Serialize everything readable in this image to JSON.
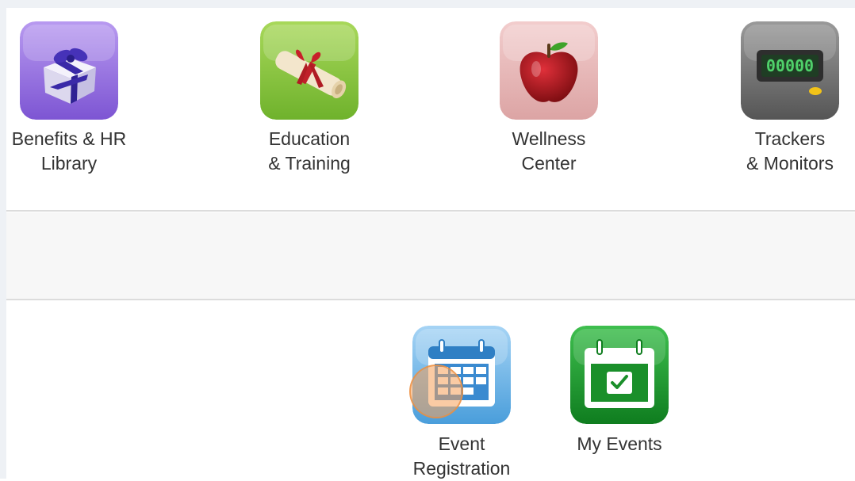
{
  "top_tiles": [
    {
      "line1": "Benefits & HR",
      "line2": "Library",
      "icon": "gift-icon",
      "color": "#9b77e0"
    },
    {
      "line1": "Education",
      "line2": "& Training",
      "icon": "diploma-scroll-icon",
      "color": "#8cc63f"
    },
    {
      "line1": "Wellness",
      "line2": "Center",
      "icon": "apple-icon",
      "color": "#e8b6b6"
    },
    {
      "line1": "Trackers",
      "line2": "& Monitors",
      "icon": "pedometer-icon",
      "color": "#707070"
    }
  ],
  "events": [
    {
      "line1": "Event",
      "line2": "Registration",
      "icon": "calendar-grid-icon",
      "color": "#6bb4e6"
    },
    {
      "line1": "My Events",
      "line2": "",
      "icon": "calendar-check-icon",
      "color": "#1f9a2e"
    }
  ],
  "colors": {
    "page_bg": "#ffffff",
    "frame_bg": "#eef1f5",
    "divider": "#dcdcdc",
    "band_bg": "#f7f7f7",
    "click_marker": "#f5a05a"
  }
}
